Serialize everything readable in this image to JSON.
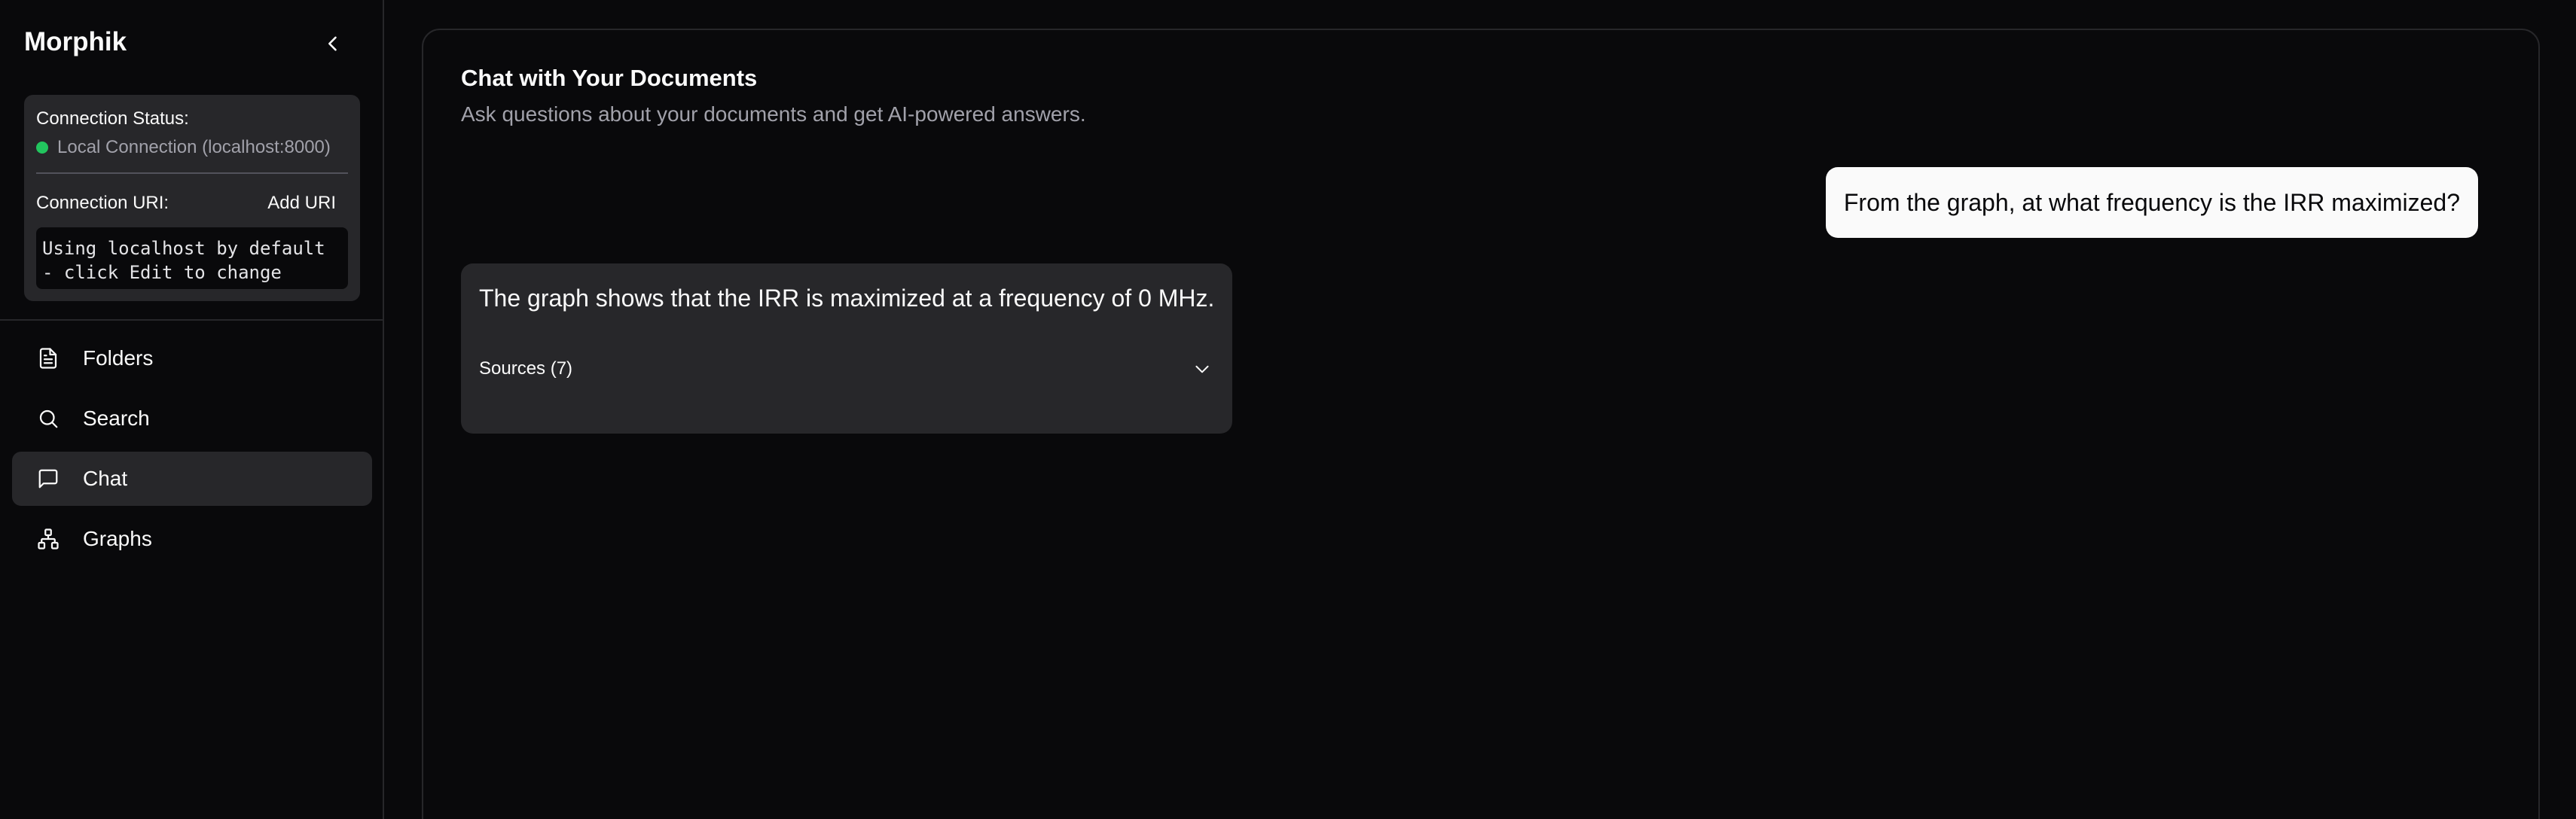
{
  "sidebar": {
    "brand": "Morphik",
    "connection": {
      "status_label": "Connection Status:",
      "status_text": "Local Connection (localhost:8000)",
      "status_color": "#22c55e",
      "uri_label": "Connection URI:",
      "add_uri_label": "Add URI",
      "uri_box_text": "Using localhost by default\n- click Edit to change"
    },
    "nav": [
      {
        "label": "Folders",
        "icon": "document-icon",
        "active": false
      },
      {
        "label": "Search",
        "icon": "search-icon",
        "active": false
      },
      {
        "label": "Chat",
        "icon": "chat-icon",
        "active": true
      },
      {
        "label": "Graphs",
        "icon": "graph-icon",
        "active": false
      }
    ]
  },
  "main": {
    "title": "Chat with Your Documents",
    "subtitle": "Ask questions about your documents and get AI-powered answers.",
    "messages": {
      "user": "From the graph, at what frequency is the IRR maximized?",
      "assistant": "The graph shows that the IRR is maximized at a frequency of 0 MHz.",
      "sources_label": "Sources (7)"
    }
  }
}
